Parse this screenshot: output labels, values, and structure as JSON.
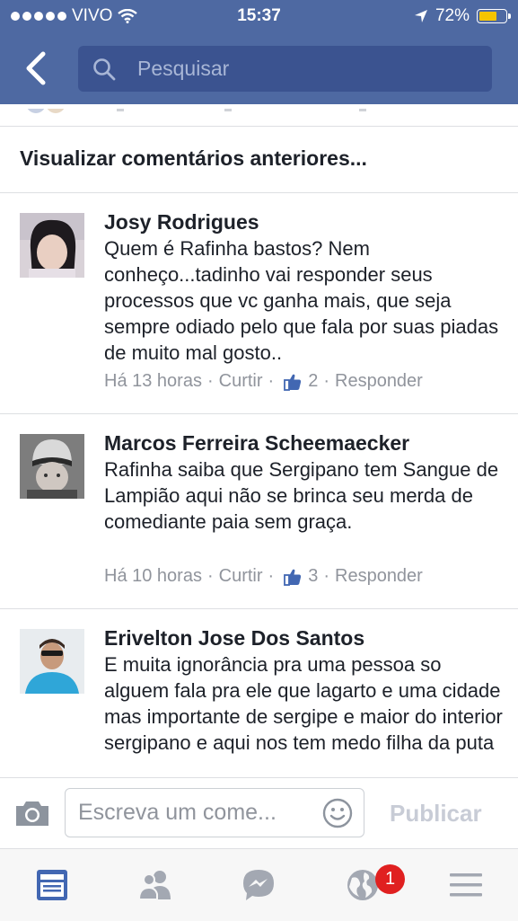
{
  "status_bar": {
    "carrier": "VIVO",
    "time": "15:37",
    "battery": "72%",
    "battery_level": 0.72
  },
  "header": {
    "back_icon": "chevron-left-icon",
    "search_placeholder": "Pesquisar"
  },
  "previous_comments_label": "Visualizar comentários anteriores...",
  "comments": [
    {
      "author": "Josy Rodrigues",
      "text": "Quem é Rafinha bastos? Nem conheço...tadinho vai responder seus processos que vc ganha mais, que seja sempre odiado pelo que fala por suas piadas de muito mal gosto..",
      "time": "Há 13 horas",
      "like_label": "Curtir",
      "likes": "2",
      "reply_label": "Responder"
    },
    {
      "author": "Marcos Ferreira Scheemaecker",
      "text": "Rafinha saiba que Sergipano tem Sangue de Lampião aqui não se brinca seu merda de comediante paia sem graça.",
      "time": "Há 10 horas",
      "like_label": "Curtir",
      "likes": "3",
      "reply_label": "Responder"
    },
    {
      "author": "Erivelton Jose Dos Santos",
      "text": "E muita ignorância pra uma pessoa so alguem fala pra ele que lagarto e uma cidade mas importante de sergipe e maior do interior sergipano e aqui nos tem medo filha da puta"
    }
  ],
  "composer": {
    "camera_icon": "camera-icon",
    "placeholder": "Escreva um come...",
    "emoji_icon": "smiley-icon",
    "publish_label": "Publicar"
  },
  "tab_bar": {
    "tabs": [
      "news-feed-icon",
      "friends-icon",
      "messenger-icon",
      "notifications-globe-icon",
      "menu-icon"
    ],
    "notification_badge": "1"
  },
  "colors": {
    "header": "#4e69a2",
    "search_field": "#3b5390",
    "active_tab": "#4267b2",
    "badge": "#e02020",
    "meta_text": "#90949c"
  }
}
